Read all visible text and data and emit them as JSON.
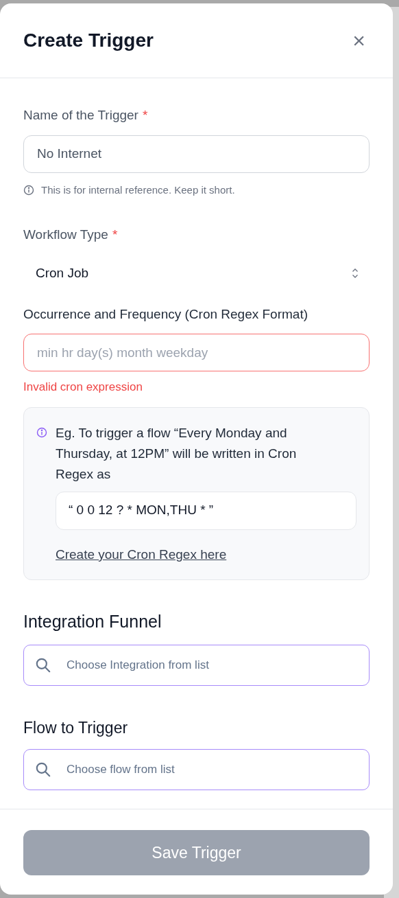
{
  "dialog": {
    "title": "Create Trigger",
    "close": "×"
  },
  "name_field": {
    "label": "Name of the Trigger",
    "required": "*",
    "value": "No Internet",
    "hint": "This is for internal reference. Keep it short."
  },
  "workflow_type": {
    "label": "Workflow Type",
    "required": "*",
    "value": "Cron Job"
  },
  "occurrence": {
    "label": "Occurrence and Frequency (Cron Regex Format)",
    "placeholder": "min hr day(s) month weekday",
    "invalid": true,
    "error": "Invalid cron expression"
  },
  "example": {
    "text": "Eg. To trigger a flow “Every Monday and Thursday, at 12PM” will be written in Cron Regex as",
    "code": "“ 0 0 12 ? * MON,THU * ”",
    "link": "Create your Cron Regex here"
  },
  "integration": {
    "label": "Integration Funnel",
    "placeholder": "Choose Integration from list"
  },
  "flow": {
    "label": "Flow to Trigger",
    "placeholder": "Choose flow from list"
  },
  "save": {
    "label": "Save Trigger",
    "disabled": true
  }
}
